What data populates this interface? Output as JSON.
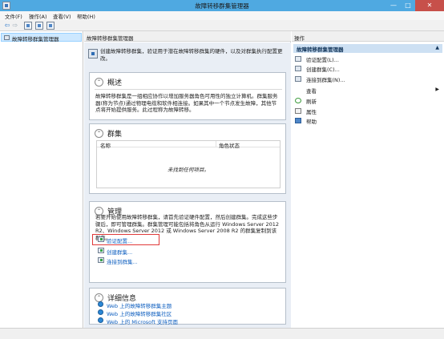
{
  "window": {
    "title": "故障转移群集管理器",
    "controls": {
      "minimize": "—",
      "maximize": "□",
      "close": "✕"
    }
  },
  "menu": [
    "文件(F)",
    "操作(A)",
    "查看(V)",
    "帮助(H)"
  ],
  "toolbar": {
    "back": "⇦",
    "forward": "⇨"
  },
  "tree": {
    "root": "故障转移群集管理器"
  },
  "center": {
    "header": "故障转移群集管理器",
    "intro": "创建故障转移群集，验证用于潜在故障转移群集的硬件，以及对群集执行配置更改。",
    "overview": {
      "title": "概述",
      "collapse": "⌃",
      "text": "故障转移群集是一组相应协作以增加服务器角色可用性的独立计算机。群集服务器(称为节点)通过物理电缆和软件相连接。如果其中一个节点发生故障，其他节点将开始提供服务。此过程称为故障转移。"
    },
    "clusters": {
      "title": "群集",
      "collapse": "⌃",
      "columns": [
        "名称",
        "角色状态"
      ],
      "empty": "未找到任何项目。"
    },
    "management": {
      "title": "管理",
      "collapse": "⌃",
      "text": "若要开始使用故障转移群集，请首先验证硬件配置，然后创建群集。完成这些步骤后，即可管理群集。群集管理可能包括将角色从运行 Windows Server 2012 R2、Windows Server 2012 或 Windows Server 2008 R2 的群集复制到该群集。",
      "links": [
        "验证配置...",
        "创建群集...",
        "连接到群集..."
      ]
    },
    "details": {
      "title": "详细信息",
      "collapse": "⌃",
      "links": [
        "Web 上的故障转移群集主题",
        "Web 上的故障转移群集社区",
        "Web 上的 Microsoft 支持页面"
      ]
    }
  },
  "actions": {
    "header": "操作",
    "section": "故障转移群集管理器",
    "section_arrow": "▲",
    "items": [
      {
        "label": "验证配置(L)...",
        "icon": "validate-icon"
      },
      {
        "label": "创建群集(C)...",
        "icon": "create-cluster-icon"
      },
      {
        "label": "连接到群集(N)...",
        "icon": "connect-cluster-icon"
      },
      {
        "label": "查看",
        "icon": "view-icon",
        "arrow": "▶"
      },
      {
        "label": "刷新",
        "icon": "refresh-icon"
      },
      {
        "label": "属性",
        "icon": "properties-icon"
      },
      {
        "label": "帮助",
        "icon": "help-icon"
      }
    ]
  },
  "colors": {
    "titlebar": "#4fa9e1",
    "close": "#c7504a",
    "link": "#1060c0",
    "highlight": "#e03a3a",
    "selection": "#cde8ff"
  }
}
